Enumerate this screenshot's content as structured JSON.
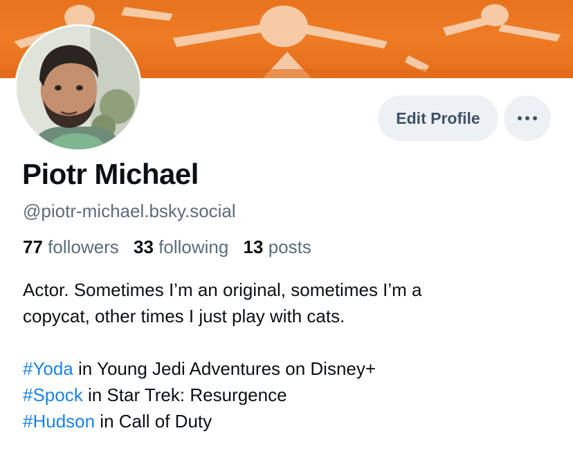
{
  "profile": {
    "name": "Piotr Michael",
    "handle": "@piotr-michael.bsky.social",
    "stats": {
      "followers_count": "77",
      "followers_label": "followers",
      "following_count": "33",
      "following_label": "following",
      "posts_count": "13",
      "posts_label": "posts"
    },
    "bio": {
      "line1": "Actor. Sometimes I’m an original, sometimes I’m a",
      "line2": "copycat, other times I just play with cats.",
      "roles": [
        {
          "tag": "#Yoda",
          "text": " in Young Jedi Adventures on Disney+"
        },
        {
          "tag": "#Spock",
          "text": " in Star Trek: Resurgence"
        },
        {
          "tag": "#Hudson",
          "text": " in Call of Duty"
        }
      ]
    }
  },
  "actions": {
    "edit_profile_label": "Edit Profile",
    "more_icon": "ellipsis-icon"
  },
  "colors": {
    "banner": "#ee7b24",
    "link": "#1a82e8",
    "button_bg": "#eef1f4",
    "muted_text": "#5b6b7c"
  }
}
